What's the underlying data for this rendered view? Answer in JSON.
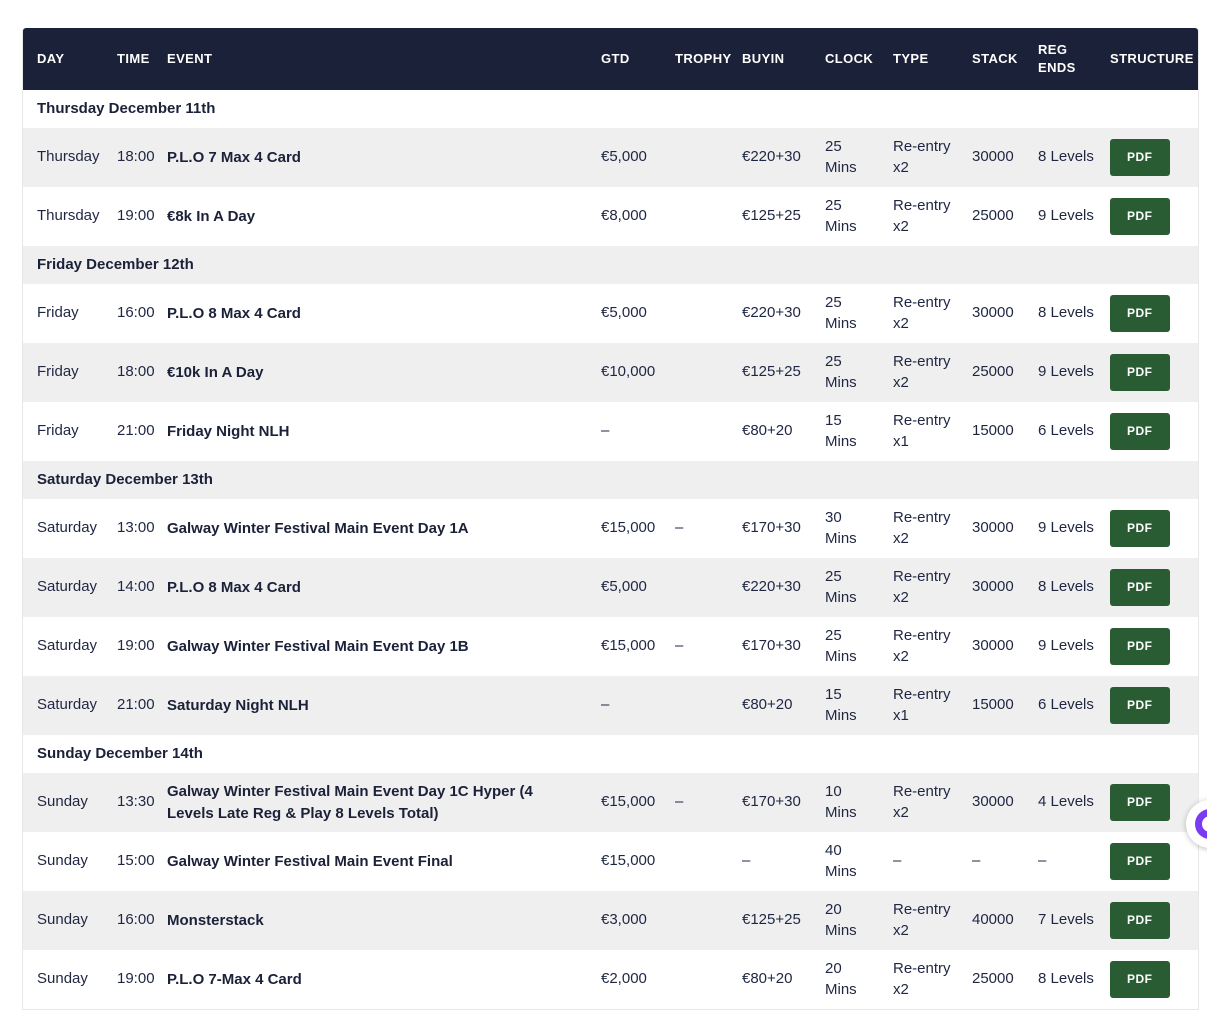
{
  "colors": {
    "header_bg": "#1b2139",
    "row_stripe": "#efefef",
    "pdf_green": "#2a5c33",
    "body_text": "#1f2642",
    "widget_purple": "#7b3bf2"
  },
  "table": {
    "columns": [
      "DAY",
      "TIME",
      "EVENT",
      "GTD",
      "TROPHY",
      "BUYIN",
      "CLOCK",
      "TYPE",
      "STACK",
      "REG ENDS",
      "STRUCTURE"
    ],
    "pdf_label": "PDF"
  },
  "sections": [
    {
      "title": "Thursday December 11th",
      "rows": [
        {
          "day": "Thursday",
          "time": "18:00",
          "event": "P.L.O 7 Max 4 Card",
          "gtd": "€5,000",
          "trophy": "",
          "buyin": "€220+30",
          "clock": "25\nMins",
          "type": "Re-entry\nx2",
          "stack": "30000",
          "reg_ends": "8 Levels"
        },
        {
          "day": "Thursday",
          "time": "19:00",
          "event": "€8k In A Day",
          "gtd": "€8,000",
          "trophy": "",
          "buyin": "€125+25",
          "clock": "25\nMins",
          "type": "Re-entry\nx2",
          "stack": "25000",
          "reg_ends": "9 Levels"
        }
      ]
    },
    {
      "title": "Friday December 12th",
      "rows": [
        {
          "day": "Friday",
          "time": "16:00",
          "event": "P.L.O 8 Max 4 Card",
          "gtd": "€5,000",
          "trophy": "",
          "buyin": "€220+30",
          "clock": "25\nMins",
          "type": "Re-entry\nx2",
          "stack": "30000",
          "reg_ends": "8 Levels"
        },
        {
          "day": "Friday",
          "time": "18:00",
          "event": "€10k In A Day",
          "gtd": "€10,000",
          "trophy": "",
          "buyin": "€125+25",
          "clock": "25\nMins",
          "type": "Re-entry\nx2",
          "stack": "25000",
          "reg_ends": "9 Levels"
        },
        {
          "day": "Friday",
          "time": "21:00",
          "event": "Friday Night NLH",
          "gtd": "–",
          "trophy": "",
          "buyin": "€80+20",
          "clock": "15 Mins",
          "type": "Re-entry\nx1",
          "stack": "15000",
          "reg_ends": "6 Levels"
        }
      ]
    },
    {
      "title": "Saturday December 13th",
      "rows": [
        {
          "day": "Saturday",
          "time": "13:00",
          "event": "Galway Winter Festival Main Event Day 1A",
          "gtd": "€15,000",
          "trophy": "–",
          "buyin": "€170+30",
          "clock": "30\nMins",
          "type": "Re-entry\nx2",
          "stack": "30000",
          "reg_ends": "9 Levels"
        },
        {
          "day": "Saturday",
          "time": "14:00",
          "event": "P.L.O 8 Max 4 Card",
          "gtd": "€5,000",
          "trophy": "",
          "buyin": "€220+30",
          "clock": "25\nMins",
          "type": "Re-entry\nx2",
          "stack": "30000",
          "reg_ends": "8 Levels"
        },
        {
          "day": "Saturday",
          "time": "19:00",
          "event": "Galway Winter Festival Main Event Day 1B",
          "gtd": "€15,000",
          "trophy": "–",
          "buyin": "€170+30",
          "clock": "25\nMins",
          "type": "Re-entry\nx2",
          "stack": "30000",
          "reg_ends": "9 Levels"
        },
        {
          "day": "Saturday",
          "time": "21:00",
          "event": "Saturday Night NLH",
          "gtd": "–",
          "trophy": "",
          "buyin": "€80+20",
          "clock": "15 Mins",
          "type": "Re-entry\nx1",
          "stack": "15000",
          "reg_ends": "6 Levels"
        }
      ]
    },
    {
      "title": "Sunday December 14th",
      "rows": [
        {
          "day": "Sunday",
          "time": "13:30",
          "event": "Galway Winter Festival Main Event Day 1C Hyper (4 Levels Late Reg & Play 8 Levels Total)",
          "gtd": "€15,000",
          "trophy": "–",
          "buyin": "€170+30",
          "clock": "10 Mins",
          "type": "Re-entry\nx2",
          "stack": "30000",
          "reg_ends": "4 Levels"
        },
        {
          "day": "Sunday",
          "time": "15:00",
          "event": "Galway Winter Festival Main Event Final",
          "gtd": "€15,000",
          "trophy": "",
          "buyin": "–",
          "clock": "40\nMins",
          "type": "–",
          "stack": "–",
          "reg_ends": "–"
        },
        {
          "day": "Sunday",
          "time": "16:00",
          "event": "Monsterstack",
          "gtd": "€3,000",
          "trophy": "",
          "buyin": "€125+25",
          "clock": "20\nMins",
          "type": "Re-entry\nx2",
          "stack": "40000",
          "reg_ends": "7 Levels"
        },
        {
          "day": "Sunday",
          "time": "19:00",
          "event": "P.L.O 7-Max 4 Card",
          "gtd": "€2,000",
          "trophy": "",
          "buyin": "€80+20",
          "clock": "20\nMins",
          "type": "Re-entry\nx2",
          "stack": "25000",
          "reg_ends": "8 Levels"
        }
      ]
    }
  ],
  "widget": {
    "name": "accessibility-widget"
  }
}
